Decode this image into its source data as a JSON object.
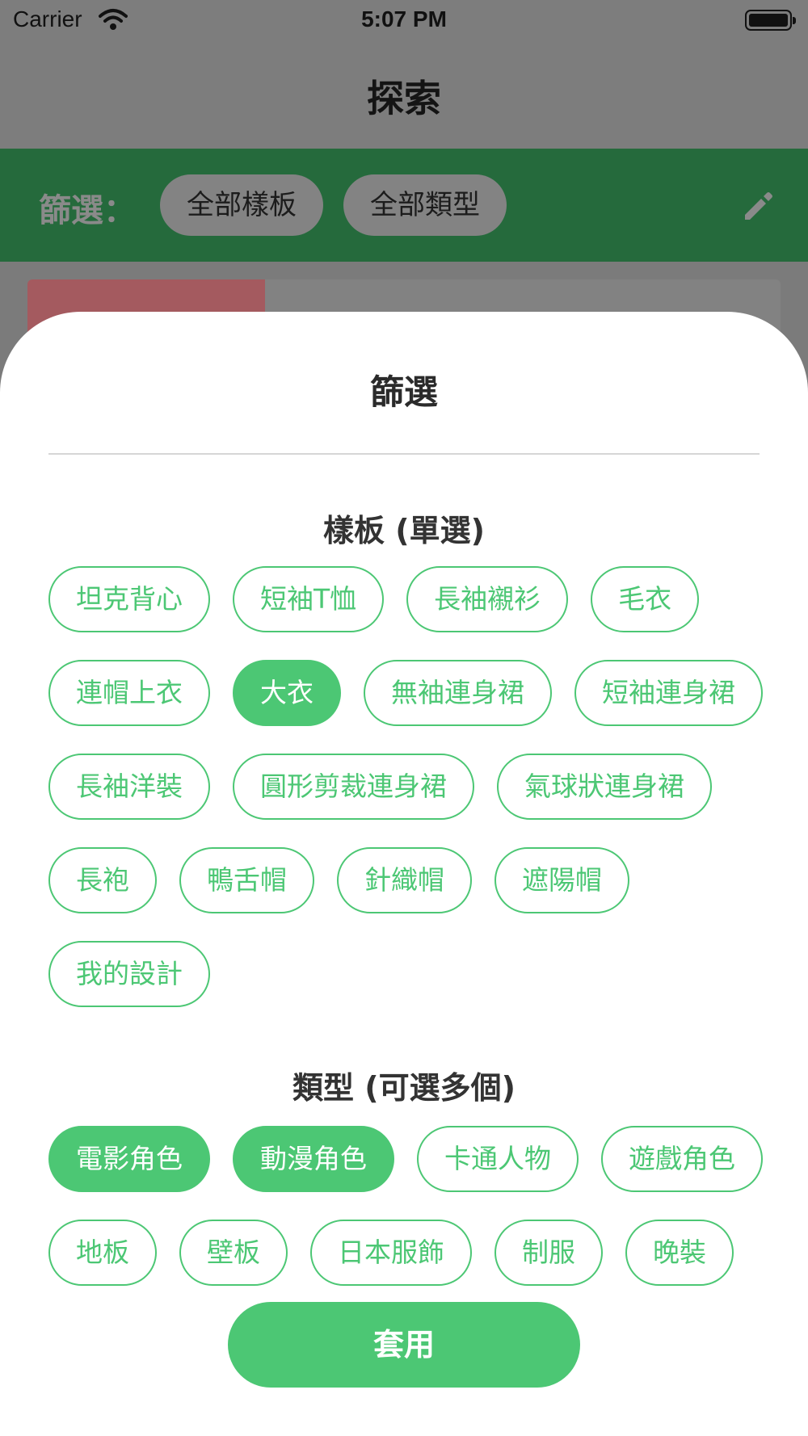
{
  "statusbar": {
    "carrier": "Carrier",
    "time": "5:07 PM"
  },
  "nav": {
    "title": "探索"
  },
  "filterbar": {
    "label": "篩選：",
    "chip_template": "全部樣板",
    "chip_type": "全部類型",
    "edit_icon": "pencil-icon"
  },
  "sheet": {
    "title": "篩選",
    "template_section": {
      "title": "樣板 (單選)",
      "rows": [
        [
          {
            "label": "坦克背心",
            "selected": false
          },
          {
            "label": "短袖T恤",
            "selected": false
          },
          {
            "label": "長袖襯衫",
            "selected": false
          },
          {
            "label": "毛衣",
            "selected": false
          }
        ],
        [
          {
            "label": "連帽上衣",
            "selected": false
          },
          {
            "label": "大衣",
            "selected": true
          },
          {
            "label": "無袖連身裙",
            "selected": false
          },
          {
            "label": "短袖連身裙",
            "selected": false
          }
        ],
        [
          {
            "label": "長袖洋裝",
            "selected": false
          },
          {
            "label": "圓形剪裁連身裙",
            "selected": false
          },
          {
            "label": "氣球狀連身裙",
            "selected": false
          }
        ],
        [
          {
            "label": "長袍",
            "selected": false
          },
          {
            "label": "鴨舌帽",
            "selected": false
          },
          {
            "label": "針織帽",
            "selected": false
          },
          {
            "label": "遮陽帽",
            "selected": false
          }
        ],
        [
          {
            "label": "我的設計",
            "selected": false
          }
        ]
      ]
    },
    "type_section": {
      "title": "類型 (可選多個)",
      "rows": [
        [
          {
            "label": "電影角色",
            "selected": true
          },
          {
            "label": "動漫角色",
            "selected": true
          },
          {
            "label": "卡通人物",
            "selected": false
          },
          {
            "label": "遊戲角色",
            "selected": false
          }
        ],
        [
          {
            "label": "地板",
            "selected": false
          },
          {
            "label": "壁板",
            "selected": false
          },
          {
            "label": "日本服飾",
            "selected": false
          },
          {
            "label": "制服",
            "selected": false
          },
          {
            "label": "晚裝",
            "selected": false
          }
        ]
      ]
    },
    "apply_label": "套用"
  },
  "colors": {
    "accent": "#4cc774",
    "filterbar_bg": "#256a3c",
    "overlay": "#7d7d7d"
  }
}
